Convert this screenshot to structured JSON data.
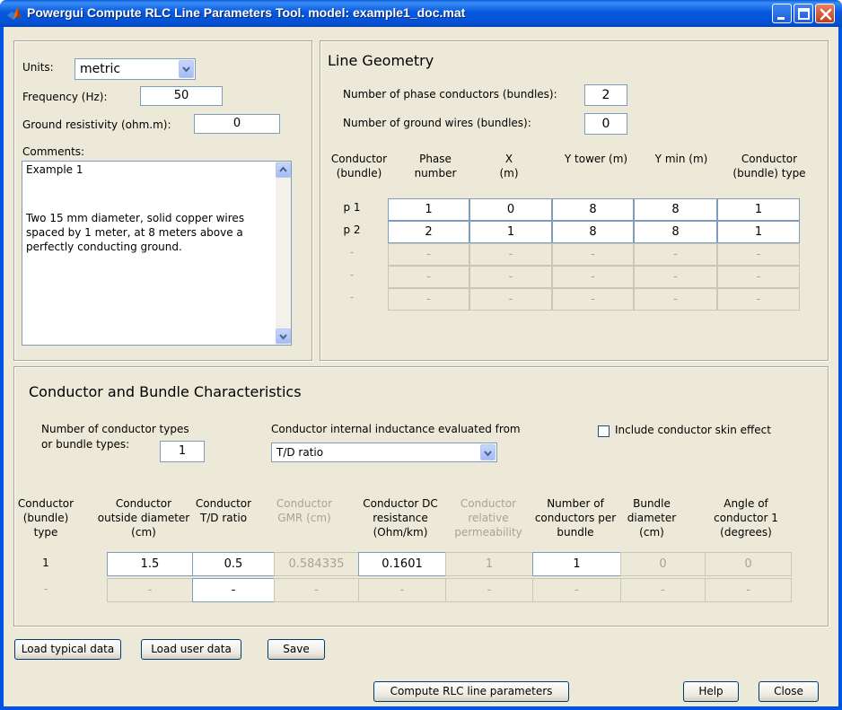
{
  "window": {
    "title": "Powergui Compute RLC Line Parameters Tool.  model: example1_doc.mat"
  },
  "settings": {
    "units_label": "Units:",
    "units_value": "metric",
    "frequency_label": "Frequency (Hz):",
    "frequency_value": "50",
    "ground_label": "Ground resistivity (ohm.m):",
    "ground_value": "0",
    "comments_label": "Comments:",
    "comments_line1": "Example 1",
    "comments_line2": "Two 15 mm diameter, solid copper wires spaced by 1 meter, at 8 meters above a perfectly conducting ground."
  },
  "geometry": {
    "title": "Line Geometry",
    "phase_label": "Number of phase conductors (bundles):",
    "phase_value": "2",
    "ground_wires_label": "Number of ground wires (bundles):",
    "ground_wires_value": "0",
    "headers": [
      "Conductor (bundle)",
      "Phase number",
      "X (m)",
      "Y tower (m)",
      "Y min (m)",
      "Conductor (bundle) type"
    ],
    "rows": [
      {
        "label": "p 1",
        "cells": [
          "1",
          "0",
          "8",
          "8",
          "1"
        ]
      },
      {
        "label": "p 2",
        "cells": [
          "2",
          "1",
          "8",
          "8",
          "1"
        ]
      },
      {
        "label": "-",
        "cells": [
          "-",
          "-",
          "-",
          "-",
          "-"
        ]
      },
      {
        "label": "-",
        "cells": [
          "-",
          "-",
          "-",
          "-",
          "-"
        ]
      },
      {
        "label": "-",
        "cells": [
          "-",
          "-",
          "-",
          "-",
          "-"
        ]
      }
    ]
  },
  "conductor": {
    "title": "Conductor and Bundle Characteristics",
    "types_label_1": "Number of conductor types",
    "types_label_2": "or bundle types:",
    "types_value": "1",
    "inductance_label": "Conductor internal inductance evaluated from",
    "inductance_value": "T/D ratio",
    "skin_label": "Include conductor skin effect",
    "skin_checked": false,
    "headers": [
      "Conductor (bundle) type",
      "Conductor outside diameter (cm)",
      "Conductor T/D ratio",
      "Conductor GMR (cm)",
      "Conductor DC resistance (Ohm/km)",
      "Conductor relative permeability",
      "Number of conductors per bundle",
      "Bundle diameter (cm)",
      "Angle of conductor 1 (degrees)"
    ],
    "rows": [
      {
        "label": "1",
        "cells": [
          "1.5",
          "0.5",
          "0.584335",
          "0.1601",
          "1",
          "1",
          "0",
          "0"
        ]
      },
      {
        "label": "-",
        "cells": [
          "-",
          "-",
          "-",
          "-",
          "-",
          "-",
          "-",
          "-"
        ]
      }
    ]
  },
  "buttons": {
    "load_typical": "Load typical data",
    "load_user": "Load user data",
    "save": "Save",
    "compute": "Compute RLC line parameters",
    "help": "Help",
    "close": "Close"
  }
}
